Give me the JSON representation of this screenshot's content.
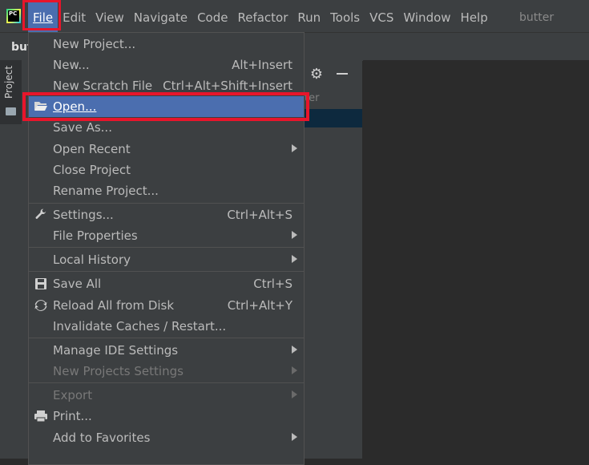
{
  "menubar": {
    "items": [
      "File",
      "Edit",
      "View",
      "Navigate",
      "Code",
      "Refactor",
      "Run",
      "Tools",
      "VCS",
      "Window",
      "Help"
    ],
    "project_name": "butter",
    "app_icon_text": "PC"
  },
  "navbar": {
    "crumb": "but"
  },
  "toolstrip": {
    "project_tab": "Project"
  },
  "panel": {
    "partial_header": "ter"
  },
  "file_menu": {
    "new_project": "New Project...",
    "new": "New...",
    "new_shortcut": "Alt+Insert",
    "new_scratch": "New Scratch File",
    "new_scratch_shortcut": "Ctrl+Alt+Shift+Insert",
    "open": "Open...",
    "save_as": "Save As...",
    "open_recent": "Open Recent",
    "close_project": "Close Project",
    "rename_project": "Rename Project...",
    "settings": "Settings...",
    "settings_shortcut": "Ctrl+Alt+S",
    "file_properties": "File Properties",
    "local_history": "Local History",
    "save_all": "Save All",
    "save_all_shortcut": "Ctrl+S",
    "reload": "Reload All from Disk",
    "reload_shortcut": "Ctrl+Alt+Y",
    "invalidate": "Invalidate Caches / Restart...",
    "manage_ide": "Manage IDE Settings",
    "new_projects_settings": "New Projects Settings",
    "export": "Export",
    "print": "Print...",
    "add_favorites": "Add to Favorites"
  },
  "colors": {
    "highlight_box": "#e8152b",
    "selection": "#4b6eaf",
    "menu_bg": "#3c3f41"
  }
}
